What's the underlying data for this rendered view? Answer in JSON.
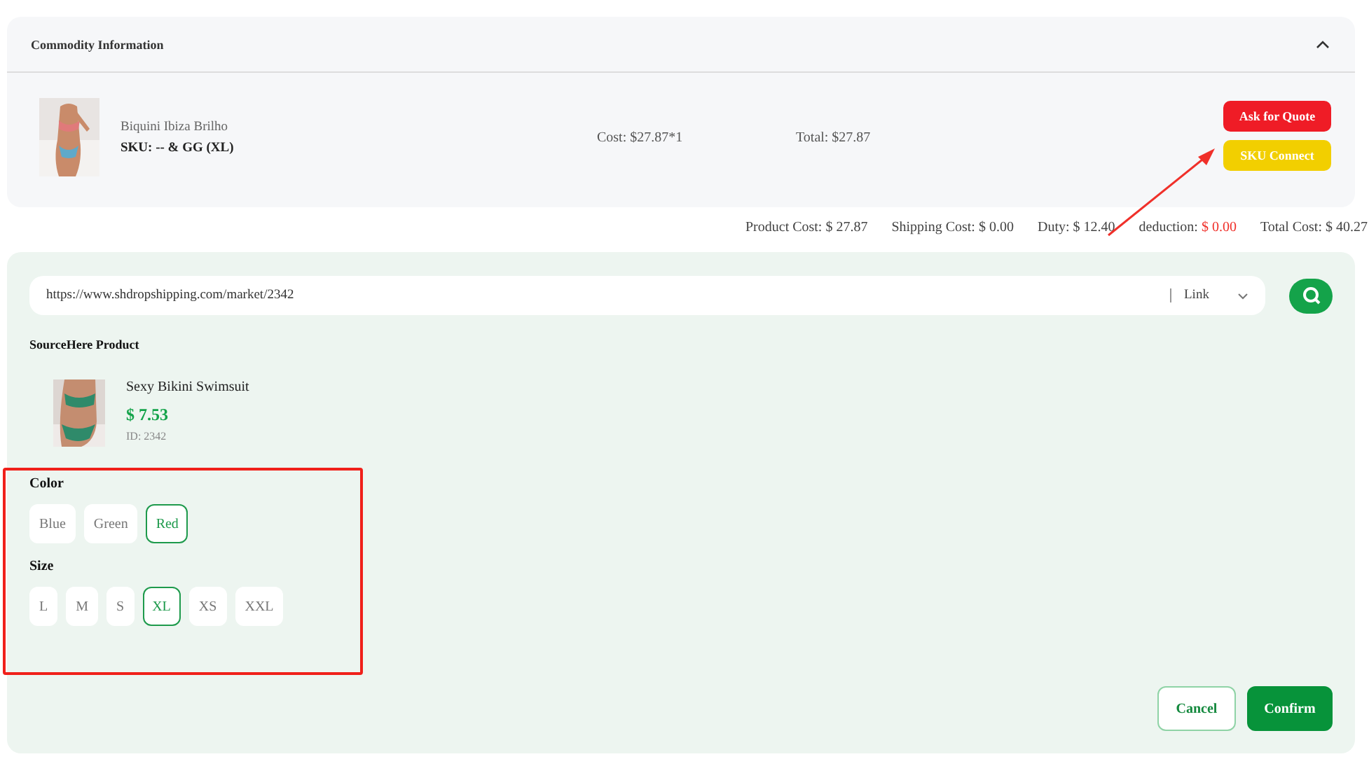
{
  "commodity": {
    "title": "Commodity Information",
    "expanded": true,
    "item": {
      "name": "Biquini Ibiza Brilho",
      "sku": "SKU: -- & GG (XL)",
      "cost": "Cost: $27.87*1",
      "total": "Total: $27.87"
    },
    "buttons": [
      {
        "label": "Ask for Quote",
        "kind": "quote"
      },
      {
        "label": "SKU Connect",
        "kind": "connect"
      }
    ]
  },
  "summary": [
    {
      "label": "Product Cost:",
      "value": "$ 27.87",
      "kind": "normal"
    },
    {
      "label": "Shipping Cost:",
      "value": "$ 0.00",
      "kind": "normal"
    },
    {
      "label": "Duty:",
      "value": "$ 12.40",
      "kind": "normal"
    },
    {
      "label": "deduction:",
      "value": "$ 0.00",
      "kind": "alert"
    },
    {
      "label": "Total Cost:",
      "value": "$ 40.27",
      "kind": "normal"
    }
  ],
  "search": {
    "value": "https://www.shdropshipping.com/market/2342",
    "mode": "Link"
  },
  "source": {
    "heading": "SourceHere Product",
    "product": {
      "name": "Sexy Bikini Swimsuit",
      "price": "$ 7.53",
      "id": "ID: 2342"
    }
  },
  "options": [
    {
      "name": "Color",
      "values": [
        {
          "label": "Blue",
          "selected": false
        },
        {
          "label": "Green",
          "selected": false
        },
        {
          "label": "Red",
          "selected": true
        }
      ]
    },
    {
      "name": "Size",
      "values": [
        {
          "label": "L",
          "selected": false
        },
        {
          "label": "M",
          "selected": false
        },
        {
          "label": "S",
          "selected": false
        },
        {
          "label": "XL",
          "selected": true
        },
        {
          "label": "XS",
          "selected": false
        },
        {
          "label": "XXL",
          "selected": false
        }
      ]
    }
  ],
  "actions": [
    {
      "label": "Cancel",
      "kind": "secondary"
    },
    {
      "label": "Confirm",
      "kind": "primary"
    }
  ]
}
